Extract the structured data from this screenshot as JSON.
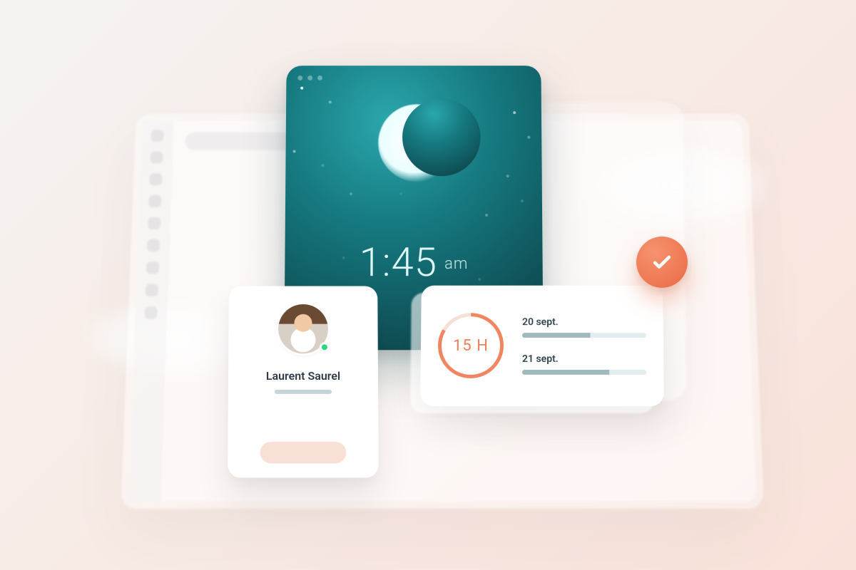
{
  "clock": {
    "time": "1:45",
    "ampm": "am"
  },
  "profile": {
    "name": "Laurent Saurel"
  },
  "hours_card": {
    "value": "15 H",
    "dates": [
      {
        "label": "20 sept."
      },
      {
        "label": "21 sept."
      }
    ]
  }
}
